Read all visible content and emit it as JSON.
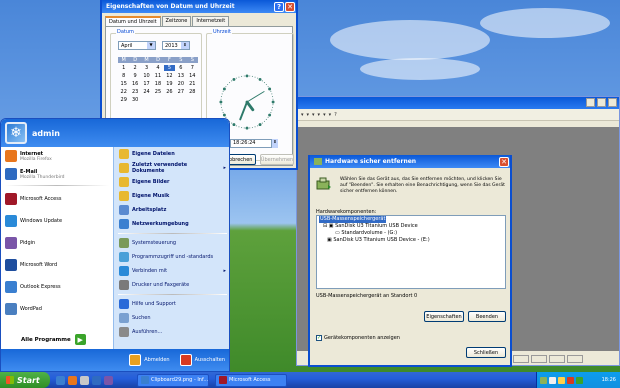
{
  "datetime_window": {
    "title": "Eigenschaften von Datum und Uhrzeit",
    "tabs": [
      "Datum und Uhrzeit",
      "Zeitzone",
      "Internetzeit"
    ],
    "date_group": "Datum",
    "time_group": "Uhrzeit",
    "month": "April",
    "year": "2013",
    "weekday_headers": [
      "M",
      "D",
      "M",
      "D",
      "F",
      "S",
      "S"
    ],
    "days": [
      "1",
      "2",
      "3",
      "4",
      "5",
      "6",
      "7",
      "8",
      "9",
      "10",
      "11",
      "12",
      "13",
      "14",
      "15",
      "16",
      "17",
      "18",
      "19",
      "20",
      "21",
      "22",
      "23",
      "24",
      "25",
      "26",
      "27",
      "28",
      "29",
      "30"
    ],
    "today": "5",
    "time": "18:26:24",
    "cancel_label": "Abbrechen",
    "apply_label": "Übernehmen"
  },
  "hardware_dialog": {
    "title": "Hardware sicher entfernen",
    "message": "Wählen Sie das Gerät aus, das Sie entfernen möchten, und klicken Sie auf \"Beenden\". Sie erhalten eine Benachrichtigung, wenn Sie das Gerät sicher entfernen können.",
    "components_label": "Hardwarekomponenten:",
    "tree": [
      "USB-Massenspeichergerät",
      "SanDisk U3 Titanium USB Device",
      "Standardvolume - (G:)",
      "SanDisk U3 Titanium USB Device - (E:)"
    ],
    "status": "USB-Massenspeichergerät an Standort 0",
    "properties_label": "Eigenschaften",
    "stop_label": "Beenden",
    "checkbox_label": "Gerätekomponenten anzeigen",
    "checkbox_checked": true,
    "close_label": "Schließen"
  },
  "start_menu": {
    "username": "admin",
    "pinned": [
      {
        "label": "Internet",
        "sub": "Mozilla Firefox",
        "color": "#e8761d"
      },
      {
        "label": "E-Mail",
        "sub": "Mozilla Thunderbird",
        "color": "#2f6bc1"
      }
    ],
    "recent": [
      {
        "label": "Microsoft Access",
        "color": "#a01828"
      },
      {
        "label": "Windows Update",
        "color": "#2a8ad8"
      },
      {
        "label": "Pidgin",
        "color": "#7a55a8"
      },
      {
        "label": "Microsoft Word",
        "color": "#1f4e9e"
      },
      {
        "label": "Outlook Express",
        "color": "#3a7fd0"
      },
      {
        "label": "WordPad",
        "color": "#4a7fc0"
      }
    ],
    "all_programs": "Alle Programme",
    "right_items": [
      {
        "label": "Eigene Dateien",
        "bold": true,
        "arrow": false
      },
      {
        "label": "Zuletzt verwendete Dokumente",
        "bold": true,
        "arrow": true
      },
      {
        "label": "Eigene Bilder",
        "bold": true,
        "arrow": false
      },
      {
        "label": "Eigene Musik",
        "bold": true,
        "arrow": false
      },
      {
        "label": "Arbeitsplatz",
        "bold": true,
        "arrow": false
      },
      {
        "label": "Netzwerkumgebung",
        "bold": true,
        "arrow": false
      },
      {
        "label": "Systemsteuerung",
        "bold": false,
        "arrow": false
      },
      {
        "label": "Programmzugriff und -standards",
        "bold": false,
        "arrow": false
      },
      {
        "label": "Verbinden mit",
        "bold": false,
        "arrow": true
      },
      {
        "label": "Drucker und Faxgeräte",
        "bold": false,
        "arrow": false
      },
      {
        "label": "Hilfe und Support",
        "bold": false,
        "arrow": false
      },
      {
        "label": "Suchen",
        "bold": false,
        "arrow": false
      },
      {
        "label": "Ausführen...",
        "bold": false,
        "arrow": false
      }
    ],
    "logoff_label": "Abmelden",
    "shutdown_label": "Ausschalten"
  },
  "taskbar": {
    "start_label": "Start",
    "tasks": [
      {
        "label": "Clipboard29.png - Inf...",
        "color": "#3a7fd0"
      },
      {
        "label": "Microsoft Access",
        "color": "#a01828"
      }
    ],
    "clock": "18:26"
  },
  "colors": {
    "xp_blue": "#0a58d8",
    "start_green": "#3aa42a",
    "selection": "#316ac5"
  }
}
